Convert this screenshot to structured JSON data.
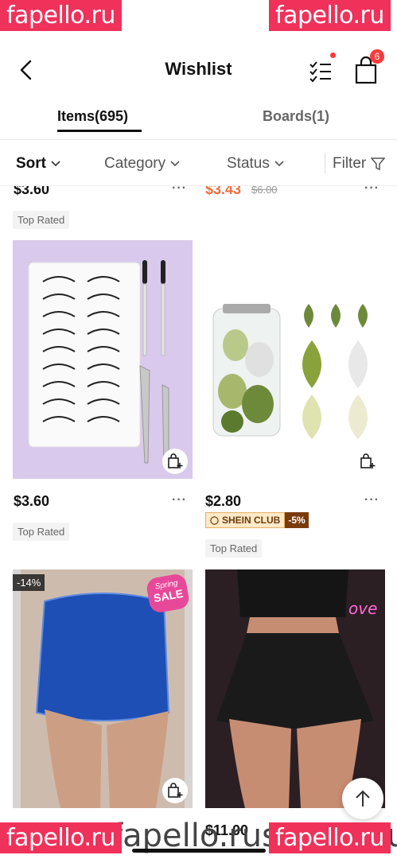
{
  "header": {
    "title": "Wishlist",
    "cart_count": "6"
  },
  "tabs": [
    {
      "label": "Items(695)"
    },
    {
      "label": "Boards(1)"
    }
  ],
  "filters": {
    "sort": "Sort",
    "category": "Category",
    "status": "Status",
    "filter": "Filter"
  },
  "top_row": {
    "left": {
      "price": "$3.60",
      "tag": "Top Rated"
    },
    "right": {
      "price": "$3.43",
      "old_price": "$6.00"
    }
  },
  "products": [
    {
      "price": "$3.60",
      "tag": "Top Rated"
    },
    {
      "price": "$2.80",
      "club_label": "SHEIN CLUB",
      "club_discount": "-5%",
      "tag": "Top Rated"
    }
  ],
  "bottom_row": {
    "left": {
      "discount": "-14%",
      "sale_badge_top": "Spring",
      "sale_badge_bottom": "SALE"
    },
    "right": {
      "price": "$11.00"
    }
  },
  "more_label": "···",
  "watermark": {
    "text": "fapello.ru",
    "url": "fapello.rus.com/au"
  },
  "colors": {
    "accent": "#fa3a3a",
    "sale_price": "#f06c3b",
    "watermark": "#f0315a"
  }
}
